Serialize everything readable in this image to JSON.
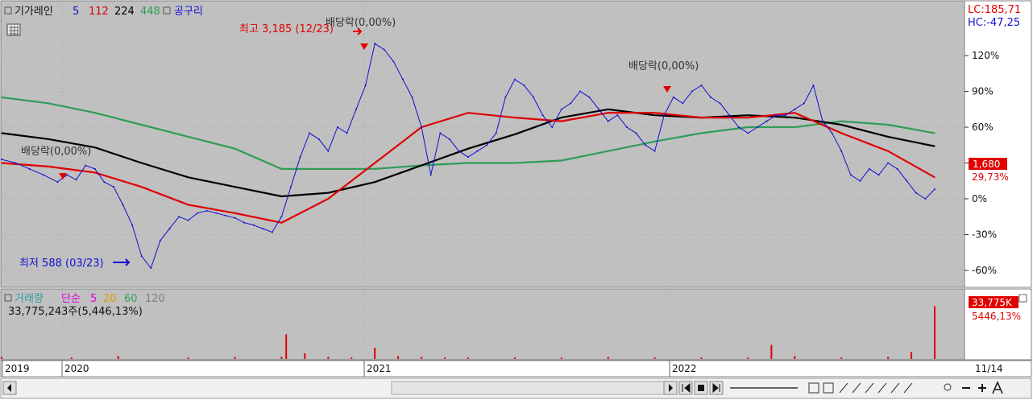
{
  "legend": {
    "ma_label": "기가레인",
    "ma_periods": [
      "5",
      "112",
      "224",
      "448"
    ],
    "ma_colors": [
      "#1010d0",
      "#e00000",
      "#000000",
      "#2f9d57"
    ],
    "overlay_label": "공구리",
    "overlay_color": "#1010d0"
  },
  "right_info": {
    "lc": "LC:185,71",
    "hc": "HC:-47,25"
  },
  "price_badge": {
    "price": "1,680",
    "pct": "29,73%"
  },
  "annotations": {
    "high": "최고 3,185 (12/23)",
    "low": "최저 588 (03/23)",
    "dividend_labels": [
      "배당락(0,00%)",
      "배당락(0,00%)",
      "배당락(0,00%)"
    ]
  },
  "volume": {
    "legend_label": "거래량",
    "ma_label": "단순",
    "ma_periods": [
      "5",
      "20",
      "60",
      "120"
    ],
    "ma_colors": [
      "#e000e0",
      "#d4a000",
      "#2f9d57",
      "#808080"
    ],
    "info": "33,775,243주(5,446,13%)",
    "badge_value": "33,775K",
    "badge_pct": "5446,13%"
  },
  "x_axis": {
    "years": [
      "2019",
      "2020",
      "2021",
      "2022"
    ],
    "last_date": "11/14"
  },
  "chart_data": {
    "type": "line",
    "title": "기가레인",
    "y_axis_unit": "% from base",
    "yticks": [
      120,
      90,
      60,
      30,
      0,
      -30,
      -60
    ],
    "ytick_labels": [
      "120%",
      "90%",
      "60%",
      "30%",
      "0%",
      "-30%",
      "-60%"
    ],
    "ylim": [
      -70,
      140
    ],
    "x_range": [
      "2019-01",
      "2022-11"
    ],
    "series": [
      {
        "name": "기가레인",
        "color": "#1010d0",
        "x": [
          0,
          3,
          6,
          9,
          12,
          14,
          16,
          18,
          20,
          22,
          24,
          26,
          28,
          30,
          32,
          34,
          36,
          38,
          40,
          42,
          44,
          46,
          48,
          50,
          52,
          54,
          56,
          58,
          60,
          62,
          64,
          66,
          68,
          70,
          72,
          74,
          76,
          78,
          80,
          82,
          84,
          86,
          88,
          90,
          92,
          94,
          96,
          98,
          100,
          102,
          104,
          106,
          108,
          110,
          112,
          114,
          116,
          118,
          120,
          122,
          124,
          126,
          128,
          130,
          132,
          134,
          136,
          138,
          140,
          142,
          144,
          146,
          148,
          150,
          152,
          154,
          156,
          158,
          160,
          162,
          164,
          166,
          168,
          170,
          172,
          174,
          176,
          178,
          180,
          182,
          184,
          186,
          188,
          190,
          192,
          194,
          196,
          198,
          200
        ],
        "y": [
          33,
          30,
          25,
          20,
          14,
          20,
          16,
          28,
          25,
          14,
          10,
          -5,
          -22,
          -48,
          -58,
          -35,
          -25,
          -15,
          -18,
          -12,
          -10,
          -12,
          -14,
          -16,
          -20,
          -22,
          -25,
          -28,
          -15,
          10,
          35,
          55,
          50,
          40,
          60,
          55,
          75,
          95,
          130,
          125,
          115,
          100,
          85,
          60,
          20,
          55,
          50,
          40,
          35,
          40,
          45,
          55,
          85,
          100,
          95,
          85,
          70,
          60,
          75,
          80,
          90,
          85,
          75,
          65,
          70,
          60,
          55,
          45,
          40,
          70,
          85,
          80,
          90,
          95,
          85,
          80,
          70,
          60,
          55,
          60,
          65,
          70,
          70,
          75,
          80,
          95,
          65,
          55,
          40,
          20,
          15,
          25,
          20,
          30,
          25,
          15,
          5,
          0,
          8
        ]
      },
      {
        "name": "112",
        "color": "#e00000",
        "x": [
          0,
          10,
          20,
          30,
          40,
          50,
          60,
          70,
          80,
          90,
          100,
          110,
          120,
          130,
          140,
          150,
          160,
          170,
          180,
          190,
          200
        ],
        "y": [
          30,
          27,
          22,
          10,
          -5,
          -12,
          -20,
          0,
          30,
          60,
          72,
          68,
          65,
          72,
          72,
          68,
          68,
          72,
          55,
          40,
          18
        ]
      },
      {
        "name": "224",
        "color": "#000000",
        "x": [
          0,
          10,
          20,
          30,
          40,
          50,
          60,
          70,
          80,
          90,
          100,
          110,
          120,
          130,
          140,
          150,
          160,
          170,
          180,
          190,
          200
        ],
        "y": [
          55,
          50,
          43,
          30,
          18,
          10,
          2,
          5,
          14,
          28,
          42,
          54,
          68,
          75,
          70,
          68,
          70,
          68,
          62,
          52,
          44
        ]
      },
      {
        "name": "448",
        "color": "#2f9d57",
        "x": [
          0,
          10,
          20,
          30,
          40,
          50,
          60,
          70,
          80,
          90,
          100,
          110,
          120,
          130,
          140,
          150,
          160,
          170,
          180,
          190,
          200
        ],
        "y": [
          85,
          80,
          72,
          62,
          52,
          42,
          25,
          25,
          25,
          28,
          30,
          30,
          32,
          40,
          48,
          55,
          60,
          60,
          65,
          62,
          55
        ]
      }
    ],
    "volume_series": {
      "x": [
        0,
        15,
        25,
        40,
        50,
        60,
        61,
        65,
        70,
        75,
        80,
        85,
        90,
        95,
        100,
        110,
        120,
        130,
        140,
        150,
        160,
        165,
        170,
        180,
        190,
        195,
        200
      ],
      "y": [
        3,
        2,
        4,
        2,
        3,
        3,
        35,
        8,
        3,
        2,
        16,
        4,
        3,
        2,
        2,
        2,
        2,
        3,
        2,
        2,
        2,
        20,
        4,
        2,
        3,
        10,
        75
      ],
      "ylim": [
        0,
        80
      ]
    }
  }
}
